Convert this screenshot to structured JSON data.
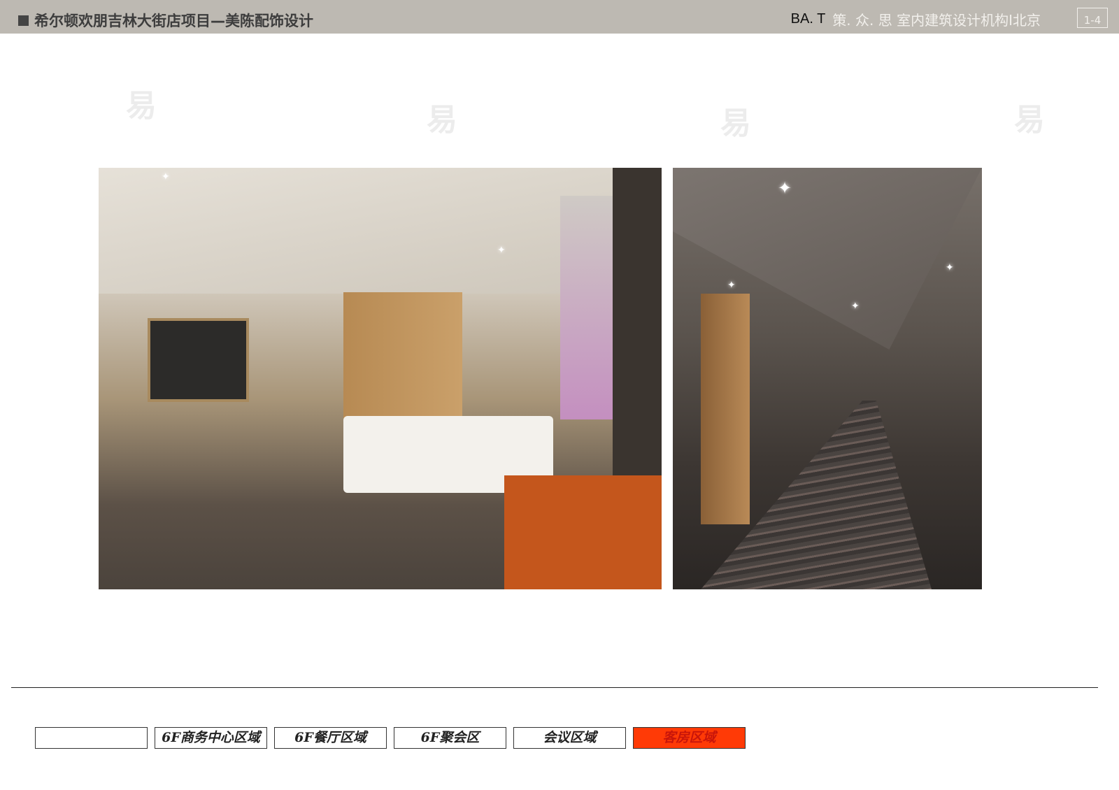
{
  "header": {
    "title": "希尔顿欢朋吉林大街店项目—美陈配饰设计",
    "brand_logo": "BA. T",
    "brand_text": "策. 众. 思  室内建筑设计机构I北京",
    "page_number": "1-4"
  },
  "images": [
    {
      "label": "guest-room-render"
    },
    {
      "label": "corridor-render"
    }
  ],
  "tabs": [
    {
      "label": ""
    },
    {
      "label": "6F商务中心区域"
    },
    {
      "label": "6F餐厅区域"
    },
    {
      "label": "6F聚会区"
    },
    {
      "label": "会议区域"
    },
    {
      "label": "客房区域",
      "active": true
    }
  ],
  "watermark": "易",
  "colors": {
    "header_bg": "#bdb9b2",
    "active_tab": "#ff3a06"
  }
}
